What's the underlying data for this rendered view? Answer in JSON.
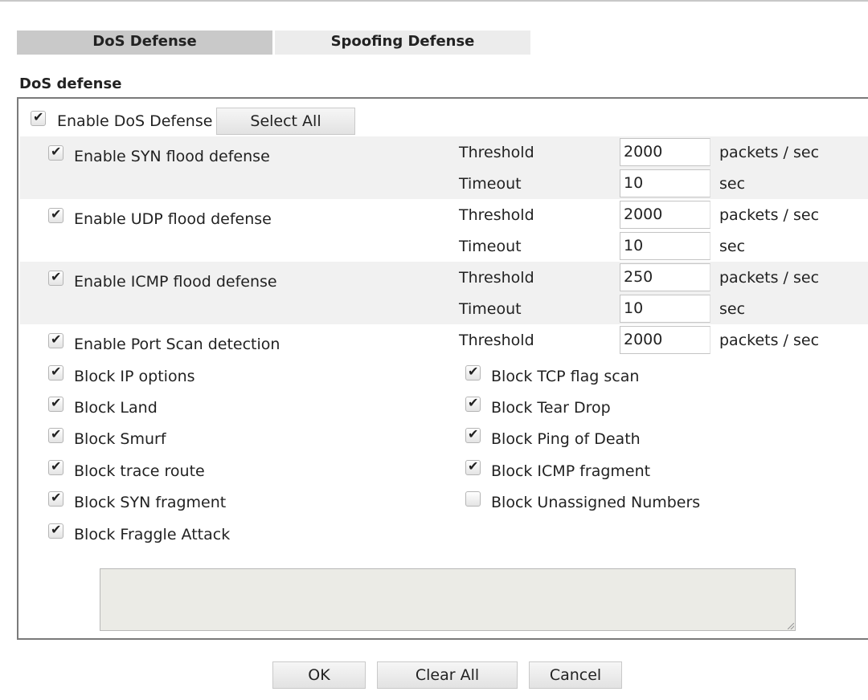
{
  "tabs": {
    "dos": "DoS Defense",
    "spoofing": "Spoofing Defense"
  },
  "section_title": "DoS defense",
  "enable_dos": {
    "label": "Enable DoS Defense",
    "checked": true
  },
  "select_all": "Select All",
  "floods": {
    "syn": {
      "label": "Enable SYN flood defense",
      "checked": true,
      "threshold_label": "Threshold",
      "threshold": "2000",
      "threshold_unit": "packets / sec",
      "timeout_label": "Timeout",
      "timeout": "10",
      "timeout_unit": "sec"
    },
    "udp": {
      "label": "Enable UDP flood defense",
      "checked": true,
      "threshold_label": "Threshold",
      "threshold": "2000",
      "threshold_unit": "packets / sec",
      "timeout_label": "Timeout",
      "timeout": "10",
      "timeout_unit": "sec"
    },
    "icmp": {
      "label": "Enable ICMP flood defense",
      "checked": true,
      "threshold_label": "Threshold",
      "threshold": "250",
      "threshold_unit": "packets / sec",
      "timeout_label": "Timeout",
      "timeout": "10",
      "timeout_unit": "sec"
    }
  },
  "port_scan": {
    "label": "Enable Port Scan detection",
    "checked": true,
    "threshold_label": "Threshold",
    "threshold": "2000",
    "threshold_unit": "packets / sec"
  },
  "left_options": [
    {
      "label": "Block IP options",
      "checked": true
    },
    {
      "label": "Block Land",
      "checked": true
    },
    {
      "label": "Block Smurf",
      "checked": true
    },
    {
      "label": "Block trace route",
      "checked": true
    },
    {
      "label": "Block SYN fragment",
      "checked": true
    },
    {
      "label": "Block Fraggle Attack",
      "checked": true
    }
  ],
  "right_options": [
    {
      "label": "Block TCP flag scan",
      "checked": true
    },
    {
      "label": "Block Tear Drop",
      "checked": true
    },
    {
      "label": "Block Ping of Death",
      "checked": true
    },
    {
      "label": "Block ICMP fragment",
      "checked": true
    },
    {
      "label": "Block Unassigned Numbers",
      "checked": false
    }
  ],
  "notes": "",
  "buttons": {
    "ok": "OK",
    "clear_all": "Clear All",
    "cancel": "Cancel"
  },
  "check_glyph": "✔"
}
